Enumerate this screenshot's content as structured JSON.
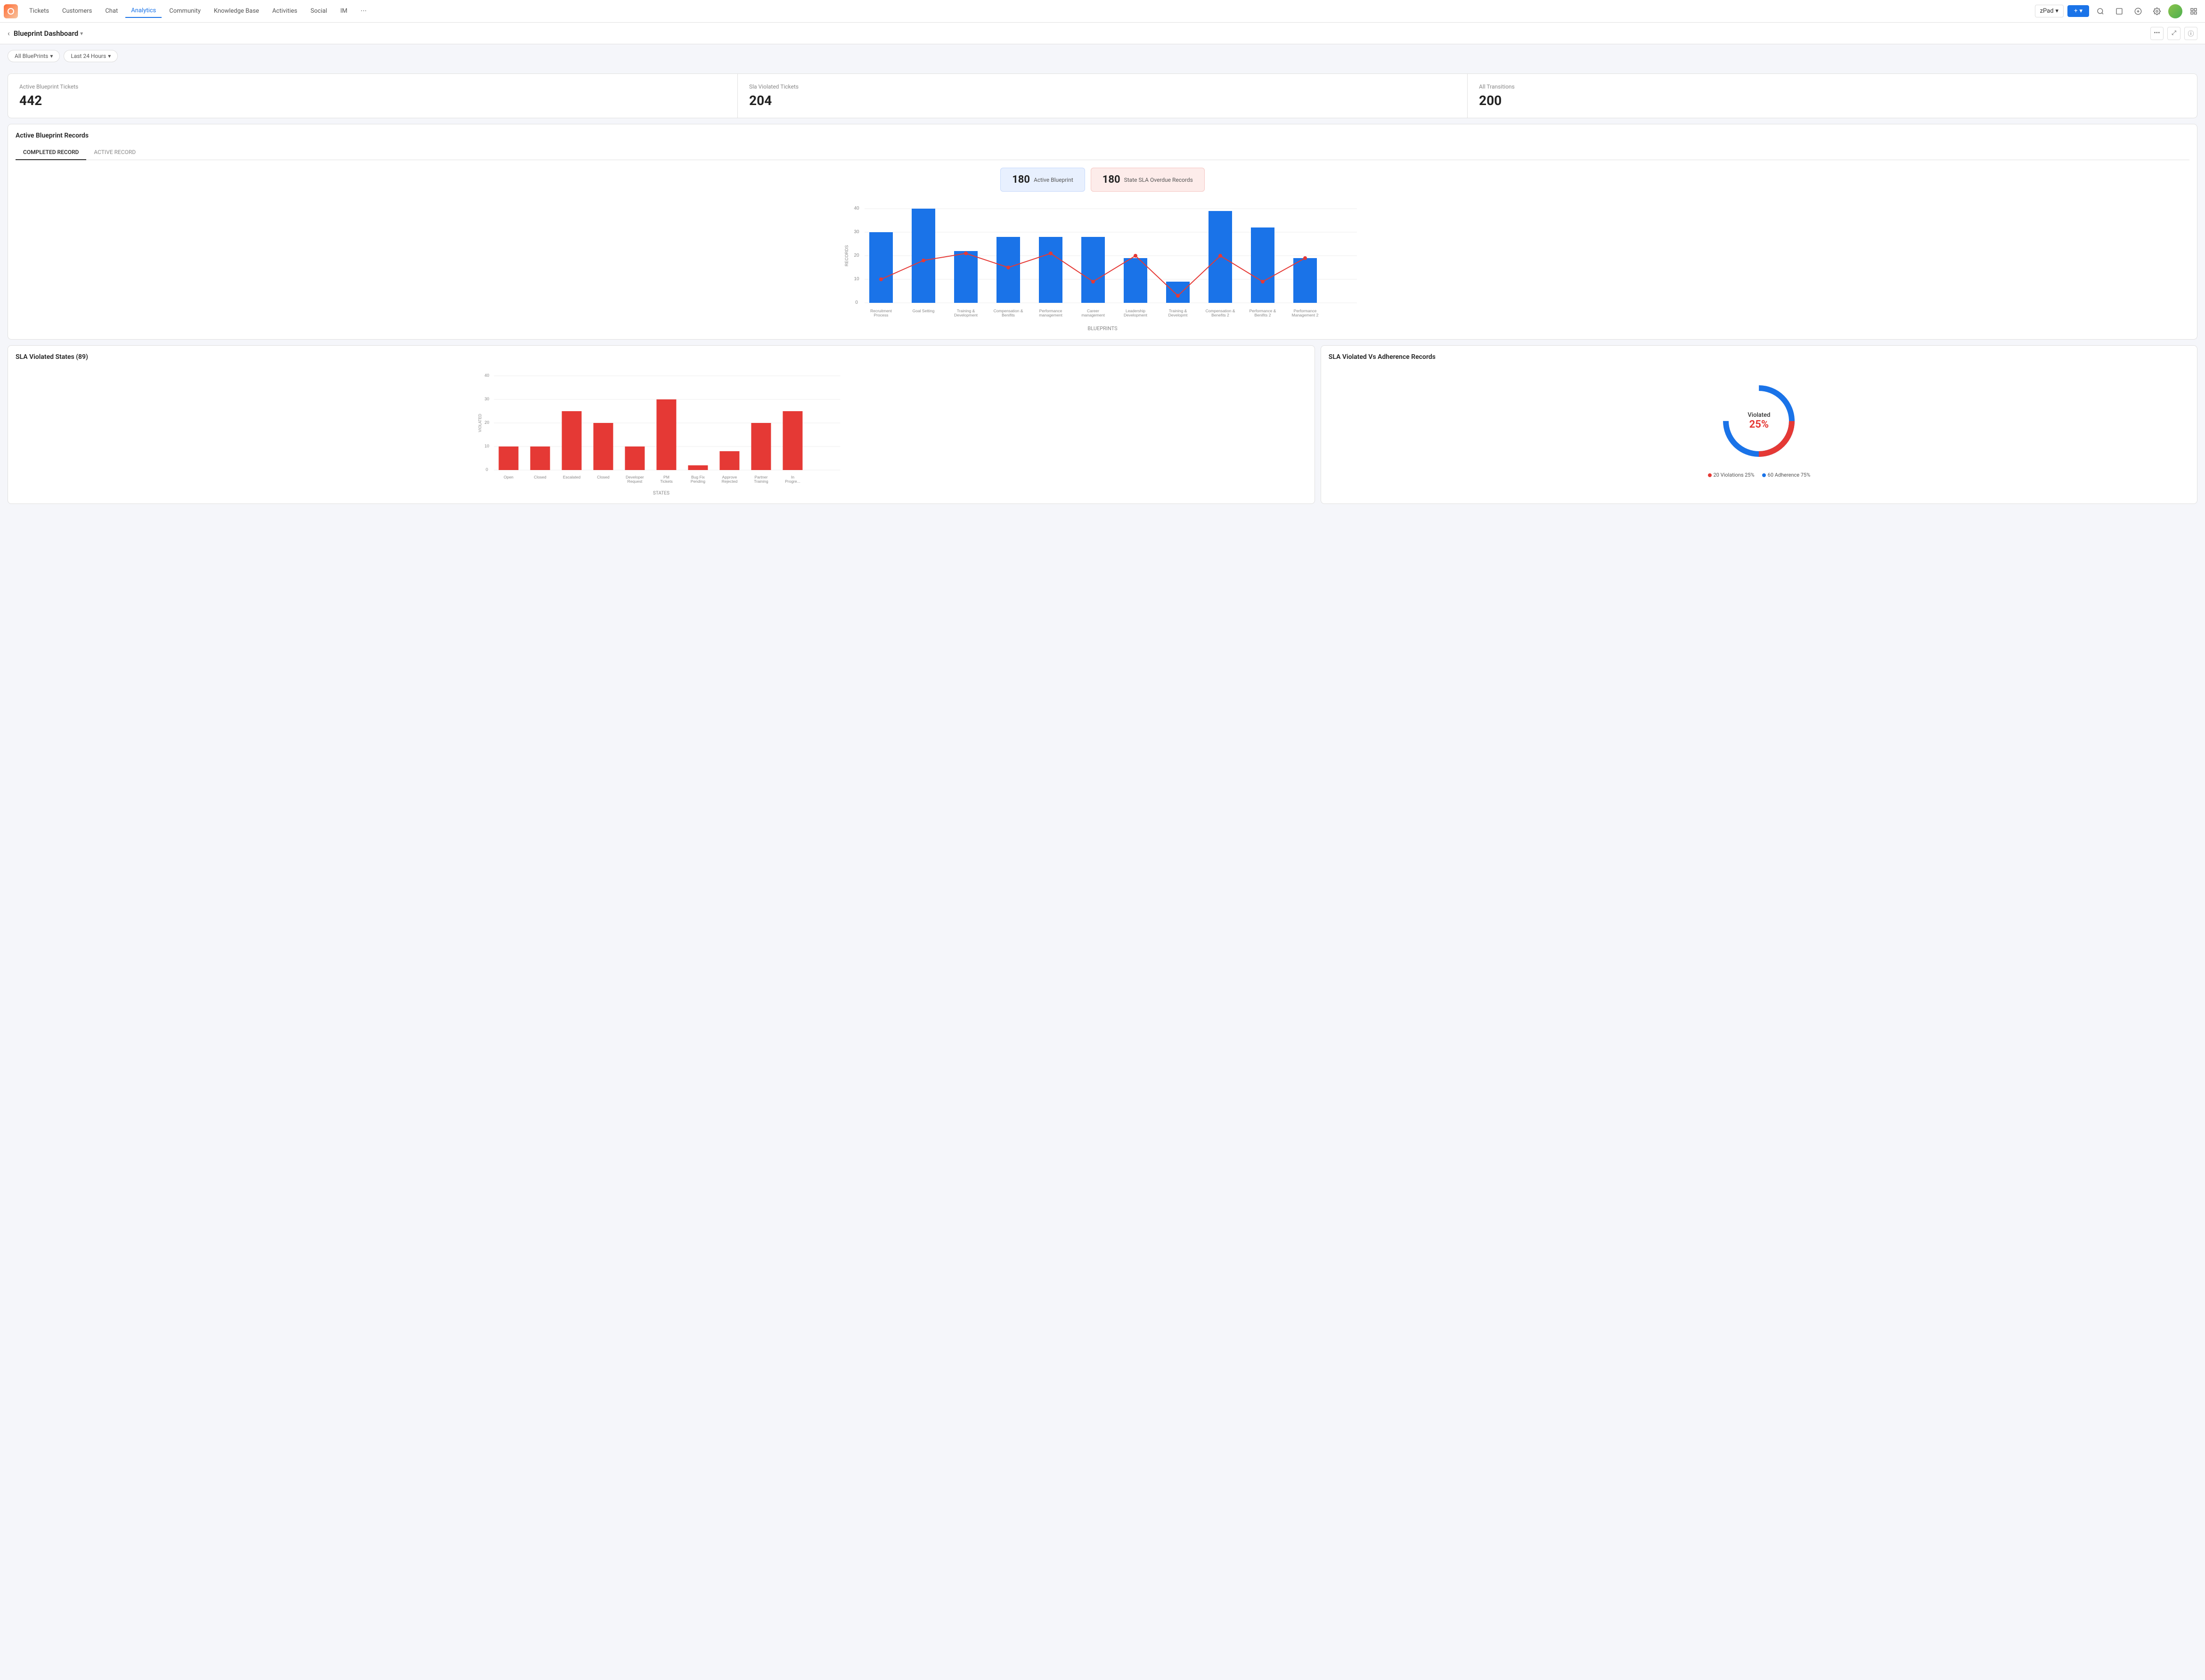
{
  "nav": {
    "logo_alt": "App Logo",
    "items": [
      {
        "label": "Tickets",
        "active": false
      },
      {
        "label": "Customers",
        "active": false
      },
      {
        "label": "Chat",
        "active": false
      },
      {
        "label": "Analytics",
        "active": true
      },
      {
        "label": "Community",
        "active": false
      },
      {
        "label": "Knowledge Base",
        "active": false
      },
      {
        "label": "Activities",
        "active": false
      },
      {
        "label": "Social",
        "active": false
      },
      {
        "label": "IM",
        "active": false
      }
    ],
    "zpad_label": "zPad",
    "add_label": "+",
    "more_label": "..."
  },
  "subheader": {
    "back_label": "‹",
    "title": "Blueprint Dashboard",
    "caret": "▾",
    "dots_label": "•••",
    "expand_label": "⤢",
    "info_label": "ⓘ"
  },
  "filters": {
    "filter1": "All BluePrints",
    "filter2": "Last 24 Hours",
    "caret": "▾"
  },
  "stats": [
    {
      "label": "Active Blueprint Tickets",
      "value": "442"
    },
    {
      "label": "Sla Violated Tickets",
      "value": "204"
    },
    {
      "label": "All Transitions",
      "value": "200"
    }
  ],
  "active_records": {
    "title": "Active Blueprint Records",
    "tabs": [
      {
        "label": "COMPLETED RECORD",
        "active": true
      },
      {
        "label": "ACTIVE RECORD",
        "active": false
      }
    ],
    "metric_active": {
      "num": "180",
      "label": "Active Blueprint"
    },
    "metric_sla": {
      "num": "180",
      "label": "State SLA Overdue Records"
    },
    "chart": {
      "y_label": "RECORDS",
      "x_label": "BLUEPRINTS",
      "y_axis": [
        40,
        30,
        20,
        10,
        0
      ],
      "bars": [
        {
          "label": "Recruitment Process",
          "value": 30
        },
        {
          "label": "Goal Setting",
          "value": 40
        },
        {
          "label": "Training &\nDevelopment",
          "value": 22
        },
        {
          "label": "Compensation &\nBenifits",
          "value": 28
        },
        {
          "label": "Performance\nmanagement",
          "value": 28
        },
        {
          "label": "Career\nmanagement",
          "value": 28
        },
        {
          "label": "Leadership\nDevelopment",
          "value": 19
        },
        {
          "label": "Training &\nDevelopment",
          "value": 9
        },
        {
          "label": "Compensation &\nBenefits 2",
          "value": 39
        },
        {
          "label": "Performance &\nBenifits 2",
          "value": 32
        },
        {
          "label": "Performance\nManagement 2",
          "value": 19
        }
      ],
      "line_points": [
        10,
        18,
        21,
        15,
        21,
        9,
        20,
        3,
        20,
        9,
        19
      ]
    }
  },
  "sla_violated": {
    "title": "SLA Violated States (89)",
    "y_label": "VIOLATED",
    "x_label": "STATES",
    "y_axis": [
      40,
      30,
      20,
      10,
      0
    ],
    "bars": [
      {
        "label": "Open",
        "value": 10
      },
      {
        "label": "Closed",
        "value": 10
      },
      {
        "label": "Escalated",
        "value": 25
      },
      {
        "label": "Closed",
        "value": 20
      },
      {
        "label": "Developer\nRequest",
        "value": 10
      },
      {
        "label": "PM\nTickets",
        "value": 30
      },
      {
        "label": "Bug Fix\nPending",
        "value": 2
      },
      {
        "label": "Approve\nRejected",
        "value": 8
      },
      {
        "label": "Partner\nTraining",
        "value": 20
      },
      {
        "label": "In\nProgre...",
        "value": 25
      }
    ]
  },
  "sla_donut": {
    "title": "SLA Violated Vs Adherence Records",
    "violated_label": "Violated",
    "violated_pct": "25%",
    "legend": [
      {
        "label": "20 Violations 25%",
        "color": "#e53935"
      },
      {
        "label": "60 Adherence 75%",
        "color": "#1a73e8"
      }
    ],
    "violated_value": 25,
    "adherence_value": 75
  }
}
